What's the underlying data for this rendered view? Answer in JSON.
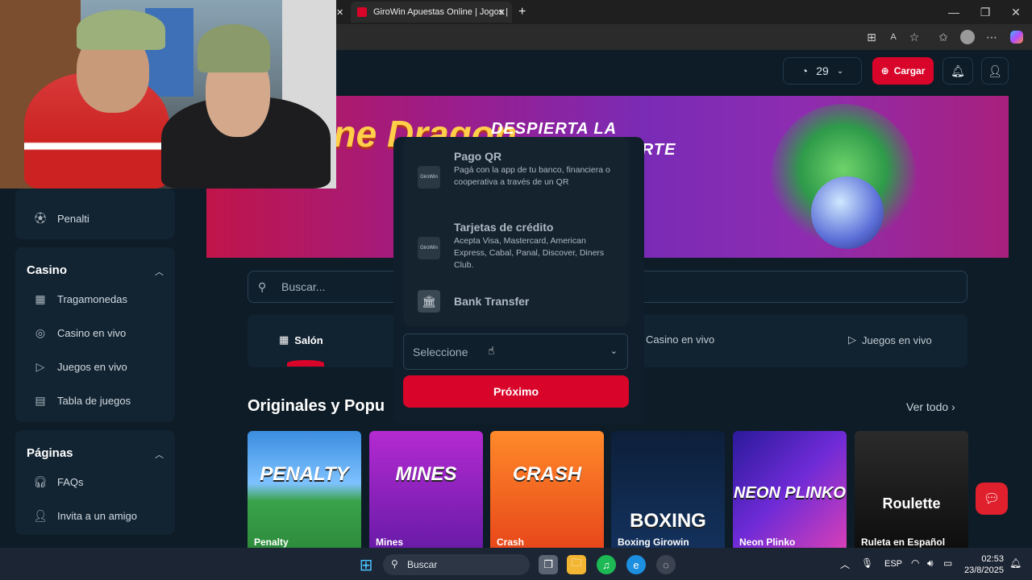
{
  "browser": {
    "tab_title": "GiroWin Apuestas Online | Jogos |",
    "new_tab_label": "+",
    "window_controls": [
      "minimize-icon",
      "restore-icon",
      "close-icon"
    ]
  },
  "header": {
    "balance": "29",
    "cargar_label": "Cargar",
    "accent_color": "#d90429"
  },
  "sidebar": {
    "top_items": [
      {
        "label": "Penalti",
        "icon": "soccer-ball-icon"
      }
    ],
    "casino": {
      "title": "Casino",
      "items": [
        {
          "label": "Tragamonedas",
          "icon": "grid-icon"
        },
        {
          "label": "Casino en vivo",
          "icon": "chips-icon"
        },
        {
          "label": "Juegos en vivo",
          "icon": "play-icon"
        },
        {
          "label": "Tabla de juegos",
          "icon": "table-icon"
        }
      ]
    },
    "paginas": {
      "title": "Páginas",
      "items": [
        {
          "label": "FAQs",
          "icon": "headset-icon"
        },
        {
          "label": "Invita a un amigo",
          "icon": "add-user-icon"
        }
      ]
    }
  },
  "banner": {
    "logo_text": "Fortune Dragon",
    "line1": "DESPIERTA LA",
    "line2": "UERTE"
  },
  "search": {
    "placeholder": "Buscar..."
  },
  "categories": [
    {
      "label": "Salón",
      "active": true
    },
    {
      "label": "Casino en vivo",
      "active": false
    },
    {
      "label": "Juegos en vivo",
      "active": false
    }
  ],
  "section": {
    "title": "Originales y Popu",
    "see_all": "Ver todo"
  },
  "games": [
    {
      "art": "PENALTY",
      "label": "Penalty"
    },
    {
      "art": "MINES",
      "label": "Mines"
    },
    {
      "art": "CRASH",
      "label": "Crash"
    },
    {
      "art": "BOXING",
      "label": "Boxing Girowin"
    },
    {
      "art": "NEON PLINKO",
      "label": "Neon Plinko"
    },
    {
      "art": "Roulette",
      "label": "Ruleta en Español"
    }
  ],
  "modal": {
    "methods": [
      {
        "title": "Pago QR",
        "desc": "Pagá con la app de tu banco, financiera o cooperativa a través de un QR",
        "logo": "GiroWin"
      },
      {
        "title": "Tarjetas de crédito",
        "desc": "Acepta Visa, Mastercard, American Express, Cabal, Panal, Discover, Diners Club.",
        "logo": "GiroWin"
      },
      {
        "title": "Bank Transfer",
        "desc": "",
        "logo": "bank-icon"
      }
    ],
    "select_value": "Seleccione",
    "next_label": "Próximo"
  },
  "taskbar": {
    "search_placeholder": "Buscar",
    "language": "ESP",
    "time": "02:53",
    "date": "23/8/2025"
  }
}
